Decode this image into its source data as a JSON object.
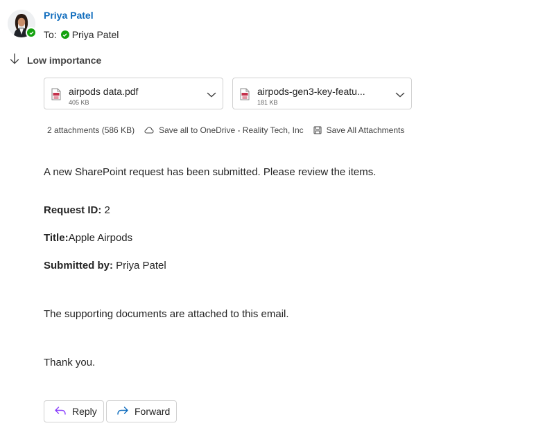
{
  "header": {
    "sender_name": "Priya Patel",
    "to_label": "To:",
    "recipient_name": "Priya Patel",
    "presence_status_color": "#13a10e"
  },
  "importance": {
    "label": "Low importance",
    "icon": "arrow-down-icon"
  },
  "attachments": {
    "items": [
      {
        "name": "airpods data.pdf",
        "size": "405 KB",
        "icon": "pdf-icon"
      },
      {
        "name": "airpods-gen3-key-featu...",
        "size": "181 KB",
        "icon": "pdf-icon"
      }
    ],
    "summary": "2 attachments (586 KB)",
    "save_onedrive_label": "Save all to OneDrive - Reality Tech, Inc",
    "save_all_label": "Save All Attachments"
  },
  "message": {
    "intro": "A new SharePoint request has been submitted. Please review the items.",
    "request_id_label": "Request ID:",
    "request_id_value": " 2",
    "title_label": "Title:",
    "title_value": "Apple Airpods",
    "submitted_by_label": "Submitted by:",
    "submitted_by_value": " Priya Patel",
    "supporting_docs": "The supporting documents are attached to this email.",
    "closing": "Thank you."
  },
  "actions": {
    "reply_label": "Reply",
    "forward_label": "Forward"
  },
  "colors": {
    "accent": "#0f6cbd",
    "presence_available": "#13a10e",
    "reply_icon": "#8a3ffc",
    "forward_icon": "#0f6cbd"
  }
}
